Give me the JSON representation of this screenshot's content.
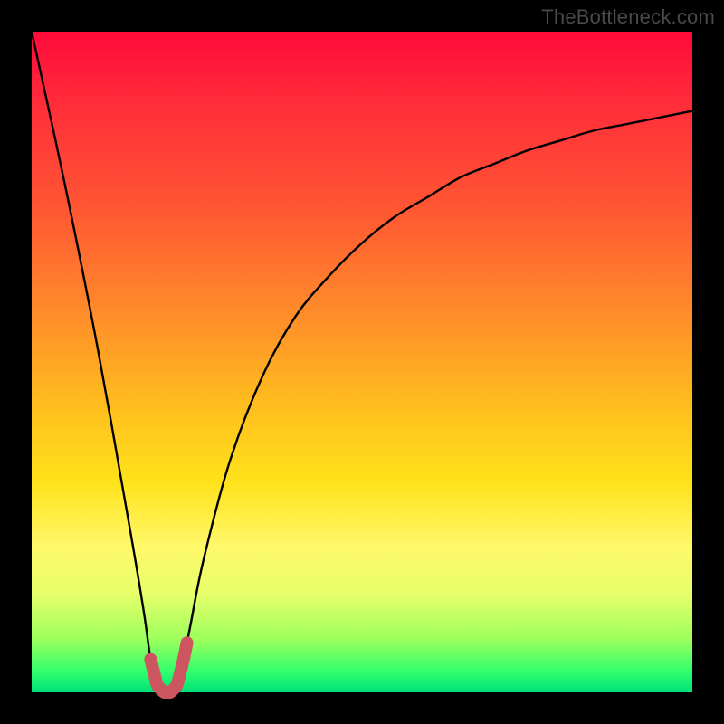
{
  "watermark": "TheBottleneck.com",
  "chart_data": {
    "type": "line",
    "title": "",
    "xlabel": "",
    "ylabel": "",
    "xlim": [
      0,
      100
    ],
    "ylim": [
      0,
      100
    ],
    "series": [
      {
        "name": "bottleneck-curve",
        "x": [
          0,
          5,
          10,
          15,
          17,
          18,
          19,
          20,
          21,
          22,
          23,
          24,
          26,
          30,
          35,
          40,
          45,
          50,
          55,
          60,
          65,
          70,
          75,
          80,
          85,
          90,
          95,
          100
        ],
        "values": [
          100,
          77,
          52,
          24,
          12,
          5,
          1,
          0,
          0,
          1,
          5,
          10,
          20,
          35,
          48,
          57,
          63,
          68,
          72,
          75,
          78,
          80,
          82,
          83.5,
          85,
          86,
          87,
          88
        ]
      }
    ],
    "highlight_region": {
      "name": "optimal-zone",
      "x_start": 18,
      "x_end": 23.5,
      "color": "#cc5560"
    },
    "gradient_stops": [
      {
        "pos": 0,
        "color": "#ff0a3a"
      },
      {
        "pos": 28,
        "color": "#ff5a32"
      },
      {
        "pos": 55,
        "color": "#ffb81f"
      },
      {
        "pos": 78,
        "color": "#fff86a"
      },
      {
        "pos": 100,
        "color": "#00e07a"
      }
    ]
  }
}
